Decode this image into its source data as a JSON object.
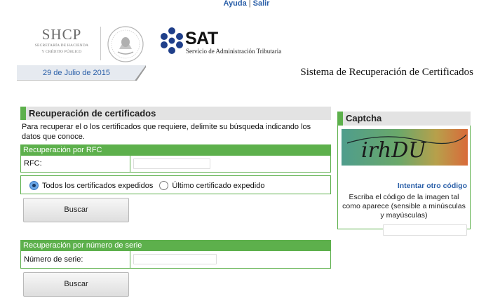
{
  "header": {
    "links": [
      "Ayuda",
      "Salir"
    ],
    "separator": "|",
    "shcp_abbr": "SHCP",
    "shcp_line1": "SECRETARÍA DE HACIENDA",
    "shcp_line2": "Y CRÉDITO PÚBLICO",
    "sat_name": "SAT",
    "sat_full": "Servicio de Administración Tributaria",
    "date": "29 de Julio de 2015",
    "system_title": "Sistema de Recuperación de Certificados"
  },
  "recovery": {
    "title": "Recuperación de certificados",
    "intro": "Para recuperar el o los certificados que requiere, delimite su búsqueda indicando los datos que conoce.",
    "rfc_section": "Recuperación por RFC",
    "rfc_label": "RFC:",
    "rfc_value": "",
    "option_all": "Todos los certificados expedidos",
    "option_last": "Último certificado expedido",
    "selected_option": "all",
    "search_button": "Buscar",
    "serial_section": "Recuperación por número de serie",
    "serial_label": "Número de serie:",
    "serial_value": "",
    "search_button_2": "Buscar"
  },
  "captcha": {
    "title": "Captcha",
    "image_text": "irhDU",
    "refresh_link": "Intentar otro código",
    "instructions": "Escriba el código de la imagen tal como aparece (sensible a minúsculas y mayúsculas)",
    "input_value": ""
  },
  "colors": {
    "accent_green": "#5db04c",
    "link_blue": "#2a5fa8",
    "sat_blue": "#1f3f8a"
  }
}
